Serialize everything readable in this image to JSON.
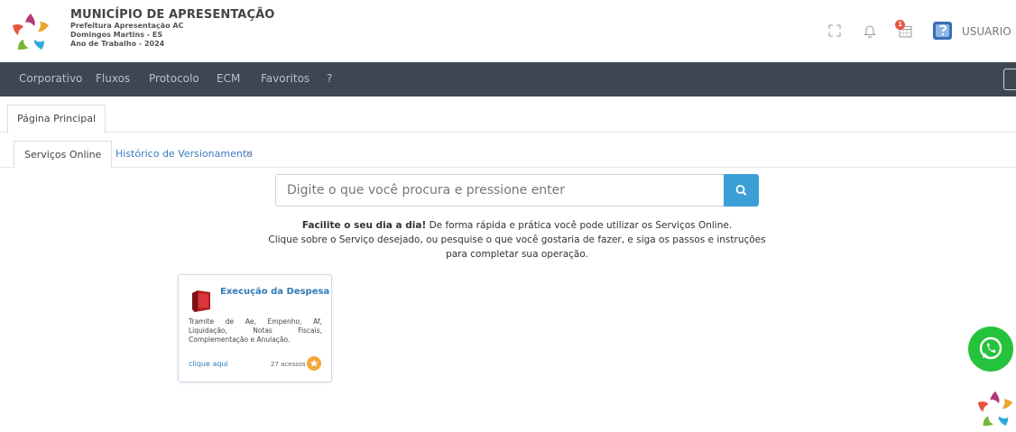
{
  "header": {
    "org_title": "MUNICÍPIO DE APRESENTAÇÃO",
    "org_line1": "Prefeitura Apresentação AC",
    "org_line2": "Domingos Martins - ES",
    "org_line3": "Ano de Trabalho - 2024",
    "notification_count": "1",
    "user_name": "USUARIO"
  },
  "nav": {
    "items": [
      "Corporativo",
      "Fluxos",
      "Protocolo",
      "ECM",
      "Favoritos",
      "?"
    ]
  },
  "page_tabs": {
    "main": "Página Principal"
  },
  "sub_tabs": {
    "active": "Serviços Online",
    "second": "Histórico de Versionamento",
    "close": "×"
  },
  "search": {
    "placeholder": "Digite o que você procura e pressione enter"
  },
  "intro": {
    "bold": "Facilite o seu dia a dia!",
    "line1_rest": " De forma rápida e prática você pode utilizar os Serviços Online.",
    "line2": "Clique sobre o Serviço desejado, ou pesquise o que você gostaria de fazer, e siga os passos e instruções para completar sua operação."
  },
  "card": {
    "title": "Execução da Despesa",
    "description": "Tramite de Ae, Empenho, Af, Liquidação, Notas Fiscais, Complementação e Anulação.",
    "link": "clique aqui",
    "access": "27 acessos"
  },
  "colors": {
    "nav_bg": "#3c4751",
    "accent": "#3c9ed6",
    "link": "#2e7ab8",
    "whatsapp": "#25c33c"
  }
}
